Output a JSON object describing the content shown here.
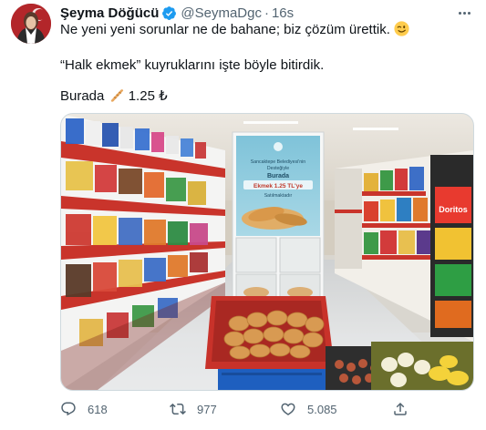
{
  "tweet": {
    "display_name": "Şeyma Döğücü",
    "handle": "@SeymaDgc",
    "separator": "·",
    "time": "16s",
    "line1": "Ne yeni yeni sorunlar ne de bahane; biz çözüm ürettik.",
    "line2": "“Halk ekmek” kuyruklarını işte böyle bitirdik.",
    "line3": "Burada",
    "price": "1.25 ₺"
  },
  "photo": {
    "sign_line1": "Sancaktepe Belediyesi'nin",
    "sign_line2": "Desteğiyle",
    "sign_line3": "Burada",
    "sign_line4": "Ekmek 1.25 TL'ye",
    "sign_line5": "Satılmaktadır",
    "chip_brand": "Doritos"
  },
  "actions": {
    "replies": "618",
    "retweets": "977",
    "likes": "5.085"
  },
  "icons": {
    "verified": "verified-badge-icon",
    "more": "more-icon",
    "reply": "reply-icon",
    "retweet": "retweet-icon",
    "like": "heart-icon",
    "share": "share-icon"
  },
  "colors": {
    "verified": "#1d9bf0",
    "muted": "#536471",
    "text": "#0f1419"
  }
}
